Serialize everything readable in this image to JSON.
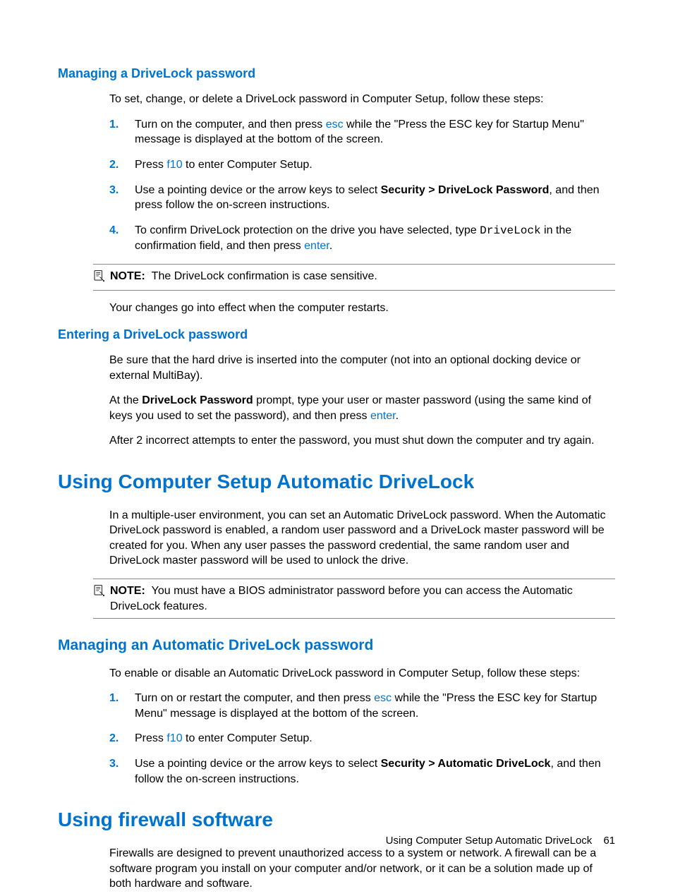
{
  "section1": {
    "title": "Managing a DriveLock password",
    "intro": "To set, change, or delete a DriveLock password in Computer Setup, follow these steps:",
    "steps": [
      {
        "pre": "Turn on the computer, and then press ",
        "key": "esc",
        "post": " while the \"Press the ESC key for Startup Menu\" message is displayed at the bottom of the screen."
      },
      {
        "pre": "Press ",
        "key": "f10",
        "post": " to enter Computer Setup."
      },
      {
        "pre": "Use a pointing device or the arrow keys to select ",
        "bold": "Security > DriveLock Password",
        "post2": ", and then press follow the on-screen instructions."
      },
      {
        "pre": "To confirm DriveLock protection on the drive you have selected, type ",
        "mono": "DriveLock",
        "mid": " in the confirmation field, and then press ",
        "key2": "enter",
        "post": "."
      }
    ],
    "note_label": "NOTE:",
    "note_body": "The DriveLock confirmation is case sensitive.",
    "after_note": "Your changes go into effect when the computer restarts."
  },
  "section2": {
    "title": "Entering a DriveLock password",
    "p1": "Be sure that the hard drive is inserted into the computer (not into an optional docking device or external MultiBay).",
    "p2_pre": "At the ",
    "p2_bold": "DriveLock Password",
    "p2_mid": " prompt, type your user or master password (using the same kind of keys you used to set the password), and then press ",
    "p2_key": "enter",
    "p2_post": ".",
    "p3": "After 2 incorrect attempts to enter the password, you must shut down the computer and try again."
  },
  "section3": {
    "title": "Using Computer Setup Automatic DriveLock",
    "p1": "In a multiple-user environment, you can set an Automatic DriveLock password. When the Automatic DriveLock password is enabled, a random user password and a DriveLock master password will be created for you. When any user passes the password credential, the same random user and DriveLock master password will be used to unlock the drive.",
    "note_label": "NOTE:",
    "note_body": "You must have a BIOS administrator password before you can access the Automatic DriveLock features."
  },
  "section4": {
    "title": "Managing an Automatic DriveLock password",
    "intro": "To enable or disable an Automatic DriveLock password in Computer Setup, follow these steps:",
    "steps": [
      {
        "pre": "Turn on or restart the computer, and then press ",
        "key": "esc",
        "post": " while the \"Press the ESC key for Startup Menu\" message is displayed at the bottom of the screen."
      },
      {
        "pre": "Press ",
        "key": "f10",
        "post": " to enter Computer Setup."
      },
      {
        "pre": "Use a pointing device or the arrow keys to select ",
        "bold": "Security > Automatic DriveLock",
        "post2": ", and then follow the on-screen instructions."
      }
    ]
  },
  "section5": {
    "title": "Using firewall software",
    "p1": "Firewalls are designed to prevent unauthorized access to a system or network. A firewall can be a software program you install on your computer and/or network, or it can be a solution made up of both hardware and software."
  },
  "footer": {
    "text": "Using Computer Setup Automatic DriveLock",
    "page": "61"
  }
}
